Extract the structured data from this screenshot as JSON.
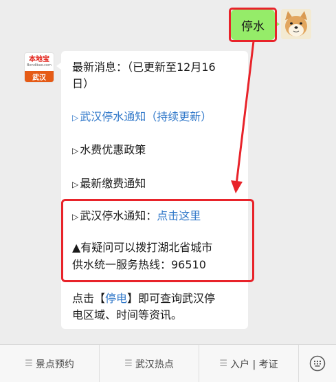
{
  "outgoing": {
    "text": "停水"
  },
  "account_logo": {
    "brand": "本地宝",
    "domain": "Bendibao.com",
    "city": "武汉"
  },
  "incoming": {
    "line1": "最新消息：（已更新至12月16",
    "line2": "日）",
    "link_notice": "武汉停水通知（持续更新）",
    "item_policy": "水费优惠政策",
    "item_payment": "最新缴费通知",
    "notice_label": "武汉停水通知：",
    "notice_link": "点击这里",
    "hotline_line1": "▲有疑问可以拨打湖北省城市",
    "hotline_line2": "供水统一服务热线：96510",
    "footer_prefix": "点击【",
    "footer_link": "停电",
    "footer_suffix": "】即可查询武汉停",
    "footer_line2": "电区域、时间等资讯。"
  },
  "menu": {
    "items": [
      {
        "label": "景点预约"
      },
      {
        "label": "武汉热点"
      },
      {
        "label": "入户 | 考证"
      }
    ]
  },
  "colors": {
    "highlight_red": "#e8232a",
    "bubble_green": "#95ec69",
    "link_blue": "#2f77c9"
  },
  "icons": {
    "menu_prefix": "hamburger-icon",
    "keyboard": "keyboard-icon",
    "triangle": "triangle-right-icon"
  }
}
